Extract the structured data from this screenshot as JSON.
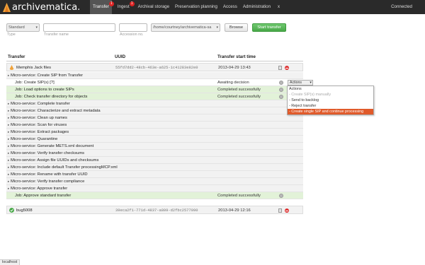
{
  "app": {
    "brand": "archivematica."
  },
  "nav": {
    "items": [
      {
        "label": "Transfer",
        "badge": "1",
        "active": true
      },
      {
        "label": "Ingest",
        "badge": "1",
        "active": false
      },
      {
        "label": "Archival storage",
        "badge": "",
        "active": false
      },
      {
        "label": "Preservation planning",
        "badge": "",
        "active": false
      },
      {
        "label": "Access",
        "badge": "",
        "active": false
      },
      {
        "label": "Administration",
        "badge": "",
        "active": false
      }
    ],
    "extra": "x",
    "status": "Connected"
  },
  "form": {
    "type_value": "Standard",
    "type_label": "Type",
    "name_label": "Transfer name",
    "accession_label": "Accession no.",
    "path_value": "/home/courtney/archivematica-sa",
    "browse_label": "Browse",
    "start_label": "Start transfer"
  },
  "table": {
    "headers": {
      "transfer": "Transfer",
      "uuid": "UUID",
      "start": "Transfer start time"
    }
  },
  "transfers": [
    {
      "name": "Memphis Jack files",
      "uuid": "55fd7dd2-48cb-463e-a625-1c41283e82e0",
      "date": "2013-04-29 13:43"
    },
    {
      "name": "bug5008",
      "uuid": "39eca2f1-771d-4837-a809-d2fbc2577090",
      "date": "2013-04-29 12:16"
    }
  ],
  "rows": [
    {
      "kind": "ms",
      "label": "Micro-service: Create SIP from Transfer"
    },
    {
      "kind": "job",
      "label": "Job: Create SIP(s) [?]",
      "status": "Awaiting decision"
    },
    {
      "kind": "jobg",
      "label": "Job: Load options to create SIPs",
      "status": "Completed successfully"
    },
    {
      "kind": "jobg",
      "label": "Job: Check transfer directory for objects",
      "status": "Completed successfully"
    },
    {
      "kind": "ms",
      "label": "Micro-service: Complete transfer"
    },
    {
      "kind": "ms",
      "label": "Micro-service: Characterize and extract metadata"
    },
    {
      "kind": "ms",
      "label": "Micro-service: Clean up names"
    },
    {
      "kind": "ms",
      "label": "Micro-service: Scan for viruses"
    },
    {
      "kind": "ms",
      "label": "Micro-service: Extract packages"
    },
    {
      "kind": "ms",
      "label": "Micro-service: Quarantine"
    },
    {
      "kind": "ms",
      "label": "Micro-service: Generate METS.xml document"
    },
    {
      "kind": "ms",
      "label": "Micro-service: Verify transfer checksums"
    },
    {
      "kind": "ms",
      "label": "Micro-service: Assign file UUIDs and checksums"
    },
    {
      "kind": "ms",
      "label": "Micro-service: Include default Transfer processingMCP.xml"
    },
    {
      "kind": "ms",
      "label": "Micro-service: Rename with transfer UUID"
    },
    {
      "kind": "ms",
      "label": "Micro-service: Verify transfer compliance"
    },
    {
      "kind": "ms",
      "label": "Micro-service: Approve transfer"
    },
    {
      "kind": "jobg",
      "label": "Job: Approve standard transfer",
      "status": "Completed successfully"
    }
  ],
  "actions": {
    "selected": "Actions",
    "options": [
      {
        "label": "Actions",
        "state": "normal"
      },
      {
        "label": "- Create SIP(s) manually",
        "state": "disabled"
      },
      {
        "label": "- Send to backlog",
        "state": "normal"
      },
      {
        "label": "- Reject transfer",
        "state": "normal"
      },
      {
        "label": "- Create single SIP and continue processing",
        "state": "selected"
      }
    ]
  },
  "statusbar": "localhost",
  "colors": {
    "navbar": "#2a2a2a",
    "accent": "#e05a2a",
    "success": "#48a848",
    "badge": "#dd2222"
  }
}
